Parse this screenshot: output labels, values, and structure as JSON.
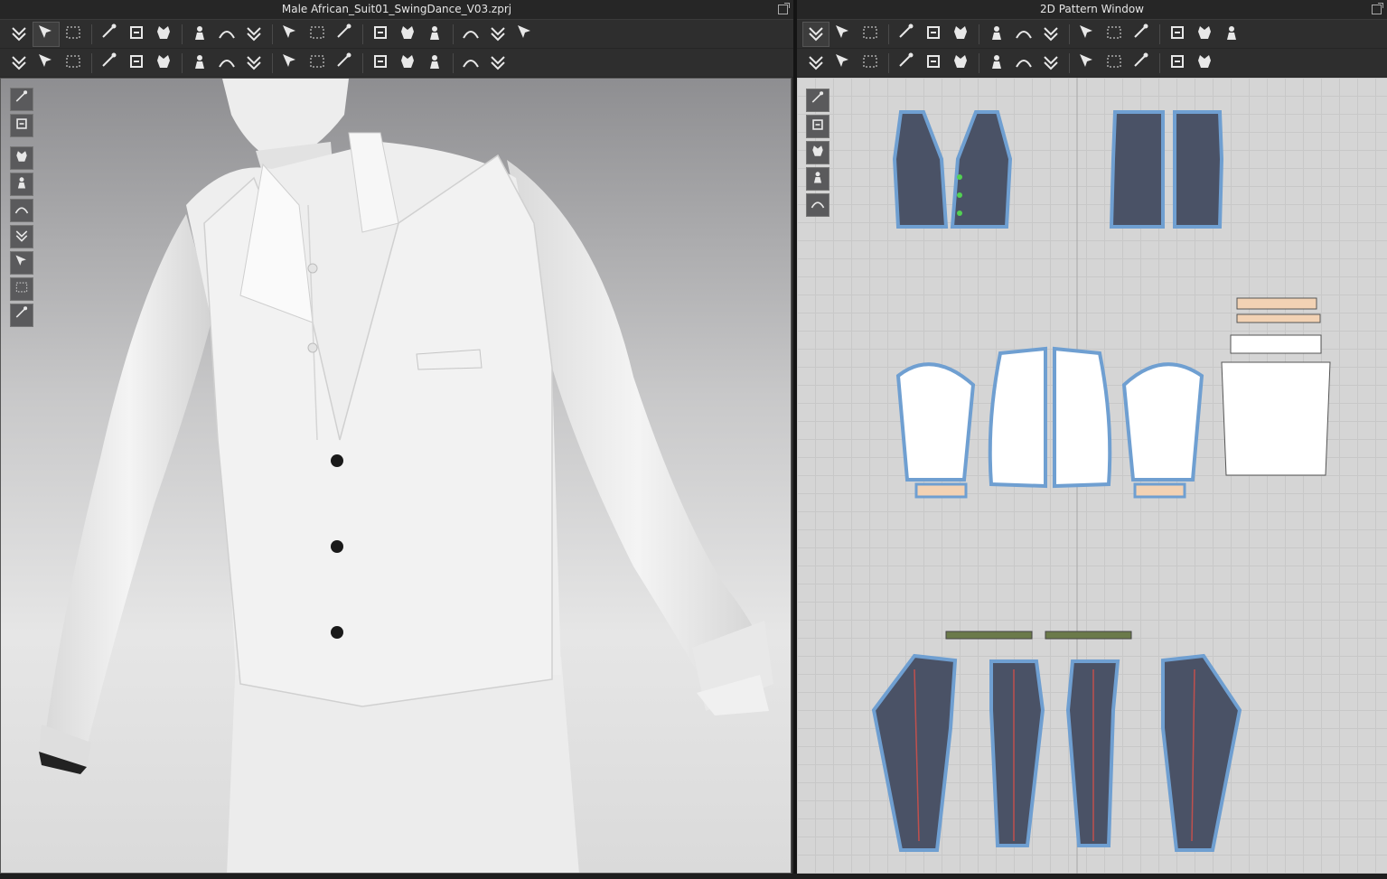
{
  "window_3d": {
    "title": "Male African_Suit01_SwingDance_V03.zprj",
    "toolbar_row1": [
      "simulate-icon",
      "transform-icon",
      "box-select-icon",
      "edit-pattern-icon",
      "fold-icon",
      "arrange-icon",
      "move-icon",
      "sewing-line-icon",
      "tuck-icon",
      "pin-icon",
      "shirt-front-icon",
      "jacket-icon",
      "avatar-icon",
      "measure-icon",
      "tape-icon",
      "ruler-icon",
      "garment-fit-icon",
      "garment-back-icon"
    ],
    "toolbar_row2": [
      "pose-icon",
      "select-mesh-icon",
      "brush-icon",
      "cut-icon",
      "strain-icon",
      "fold-arrange-icon",
      "grid-icon",
      "pattern-fill-icon",
      "button-icon",
      "buttonhole-icon",
      "lock-icon",
      "zipper-icon",
      "fabric-icon",
      "texture-icon",
      "normal-icon",
      "bump-icon",
      "align-icon"
    ],
    "side_tools": [
      "3d-view-icon",
      "garment-view-icon",
      "show-garment-icon",
      "show-fabric-icon",
      "show-avatar-icon",
      "texture-surface-icon",
      "thickness-icon",
      "skin-icon",
      "environment-icon"
    ]
  },
  "window_2d": {
    "title": "2D Pattern Window",
    "toolbar_row1": [
      "transform-pattern-icon",
      "edit-point-icon",
      "polygon-icon",
      "rectangle-icon",
      "pattern-trace-icon",
      "internal-rectangle-icon",
      "dart-icon",
      "segment-icon",
      "slash-spread-icon",
      "symmetric-icon",
      "seam-allowance-icon",
      "grainline-icon",
      "text-icon",
      "text-outline-icon",
      "annotation-icon"
    ],
    "toolbar_row2": [
      "sew-segment-icon",
      "free-sew-icon",
      "sew-edit-icon",
      "check-sewing-icon",
      "iron-icon",
      "fold-pattern-icon",
      "tack-icon",
      "tack-2d-icon",
      "topstitch-icon",
      "topstitch-free-icon",
      "stitch-icon",
      "elastic-icon",
      "puckering-icon",
      "bond-icon"
    ],
    "side_tools": [
      "pattern-edit-icon",
      "show-pattern-icon",
      "info-icon",
      "show-texture-icon",
      "lock-pattern-icon"
    ]
  },
  "colors": {
    "panel_bg": "#2c2c2c",
    "viewport_light": "#e6e6e6",
    "pattern_bg": "#d5d5d5",
    "fabric_dark": "#4a5266",
    "seam_blue": "#6f9fd1"
  }
}
